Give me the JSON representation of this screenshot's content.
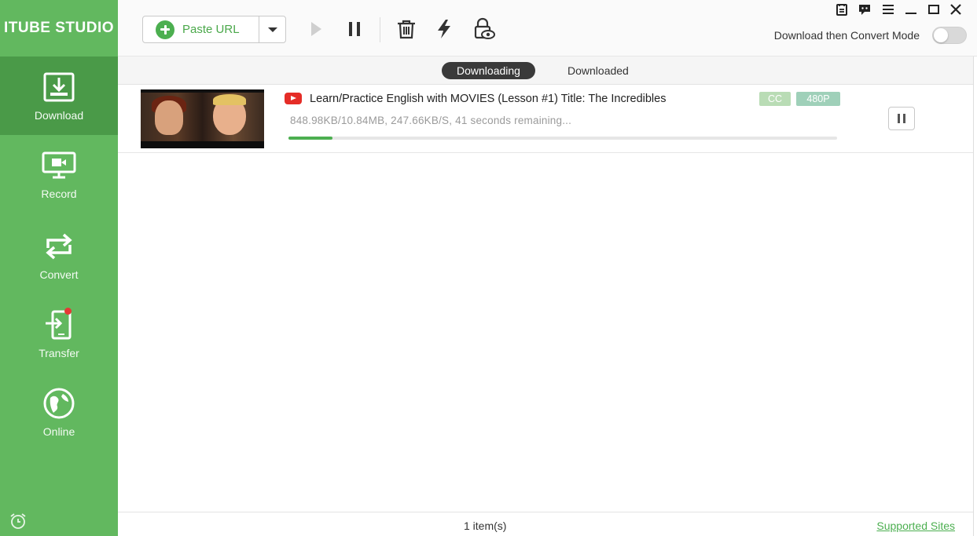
{
  "app": {
    "brand": "ITUBE STUDIO"
  },
  "sidebar": {
    "items": [
      {
        "label": "Download",
        "icon": "download-icon",
        "active": true
      },
      {
        "label": "Record",
        "icon": "record-screen-icon",
        "active": false
      },
      {
        "label": "Convert",
        "icon": "convert-icon",
        "active": false
      },
      {
        "label": "Transfer",
        "icon": "transfer-icon",
        "active": false,
        "has_badge": true
      },
      {
        "label": "Online",
        "icon": "globe-icon",
        "active": false
      }
    ],
    "footer_icon": "alarm-clock-icon"
  },
  "toolbar": {
    "paste_label": "Paste URL",
    "tools": [
      "play-icon",
      "pause-icon",
      "trash-icon",
      "lightning-icon",
      "lock-eye-icon"
    ],
    "window_controls": [
      "register-icon",
      "feedback-icon",
      "menu-icon",
      "minimize-icon",
      "maximize-icon",
      "close-icon"
    ],
    "mode_label": "Download then Convert Mode",
    "mode_enabled": false
  },
  "tabs": {
    "downloading": "Downloading",
    "downloaded": "Downloaded",
    "active": "downloading"
  },
  "downloads": [
    {
      "source": "youtube-icon",
      "title": "Learn/Practice English with MOVIES (Lesson #1) Title: The Incredibles",
      "progress_text": "848.98KB/10.84MB, 247.66KB/S, 41 seconds remaining...",
      "progress_percent": 8,
      "tags": [
        "CC",
        "480P"
      ]
    }
  ],
  "status": {
    "count": "1 item(s)",
    "supported_sites": "Supported Sites"
  },
  "colors": {
    "sidebar": "#62b85f",
    "sidebar_active": "#4a9a48",
    "accent": "#4caf50",
    "tab_active": "#3a3a3a",
    "youtube": "#e52d27"
  }
}
